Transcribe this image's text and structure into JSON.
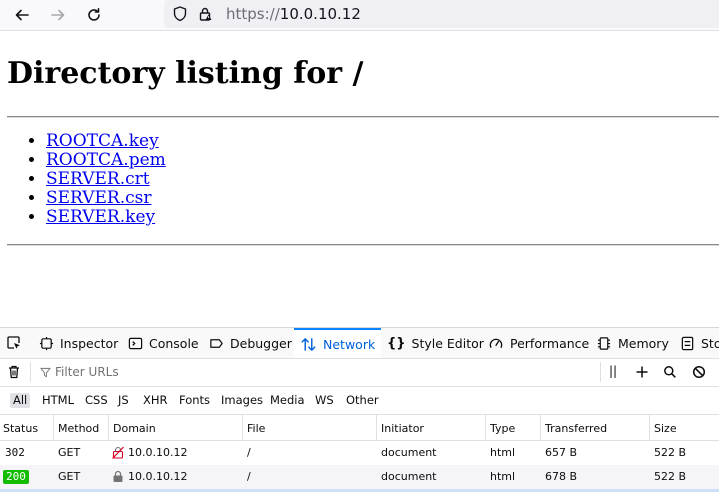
{
  "browser": {
    "url_scheme": "https://",
    "url_host": "10.0.10.12"
  },
  "page": {
    "title": "Directory listing for /",
    "files": [
      "ROOTCA.key",
      "ROOTCA.pem",
      "SERVER.crt",
      "SERVER.csr",
      "SERVER.key"
    ]
  },
  "devtools": {
    "tabs": [
      {
        "label": "Inspector",
        "icon": "inspector-icon"
      },
      {
        "label": "Console",
        "icon": "console-icon"
      },
      {
        "label": "Debugger",
        "icon": "debugger-icon"
      },
      {
        "label": "Network",
        "icon": "network-icon",
        "selected": true
      },
      {
        "label": "Style Editor",
        "icon": "style-editor-icon"
      },
      {
        "label": "Performance",
        "icon": "performance-icon"
      },
      {
        "label": "Memory",
        "icon": "memory-icon"
      },
      {
        "label": "Sto",
        "icon": "storage-icon"
      }
    ],
    "filter_placeholder": "Filter URLs",
    "type_filters": [
      "All",
      "HTML",
      "CSS",
      "JS",
      "XHR",
      "Fonts",
      "Images",
      "Media",
      "WS",
      "Other"
    ],
    "columns": [
      "Status",
      "Method",
      "Domain",
      "File",
      "Initiator",
      "Type",
      "Transferred",
      "Size"
    ],
    "requests": [
      {
        "status": "302",
        "method": "GET",
        "domain": "10.0.10.12",
        "file": "/",
        "initiator": "document",
        "type": "html",
        "transferred": "657 B",
        "size": "522 B",
        "secure": false
      },
      {
        "status": "200",
        "method": "GET",
        "domain": "10.0.10.12",
        "file": "/",
        "initiator": "document",
        "type": "html",
        "transferred": "678 B",
        "size": "522 B",
        "secure": true
      }
    ],
    "colors": {
      "accent": "#0060df",
      "status_ok": "#12bc00"
    }
  }
}
